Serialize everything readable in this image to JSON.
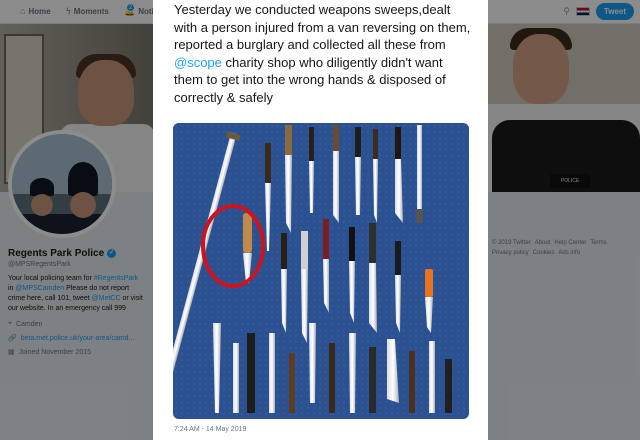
{
  "nav": {
    "home": "Home",
    "moments": "Moments",
    "notifications": "Notif",
    "notif_count": "2",
    "tweet_button": "Tweet"
  },
  "profile": {
    "name": "Regents Park Police",
    "handle": "@MPSRegentsPark",
    "bio_1": "Your local policing team for ",
    "bio_tag": "#RegentsPark",
    "bio_2": " in ",
    "bio_mention1": "@MPSCamden",
    "bio_3": " Please do not report crime here, call 101, tweet ",
    "bio_mention2": "@MetCC",
    "bio_4": " or visit our website. In an emergency call 999",
    "location": "Camden",
    "website": "beta.met.police.uk/your-area/camd...",
    "joined": "Joined November 2015"
  },
  "footer": {
    "copyright": "© 2019 Twitter",
    "about": "About",
    "help": "Help Center",
    "terms": "Terms",
    "privacy": "Privacy policy",
    "cookies": "Cookies",
    "ads": "Ads info"
  },
  "banner": {
    "badge_text": "POLICE OFFICER"
  },
  "tweet": {
    "text_before": "Yesterday we conducted weapons sweeps,dealt with a person injured from a van reversing on them, reported a burglary and collected all these from ",
    "mention": "@scope",
    "text_after": " charity shop who diligently didn't want them to get into the wrong hands & disposed of correctly & safely",
    "timestamp": "7:24 AM - 14 May 2019",
    "image_alt_icon": "photo-of-knives"
  },
  "colors": {
    "twitter_blue": "#1da1f2",
    "photo_bg": "#2b4f8a",
    "highlight_red": "#d0121b"
  }
}
